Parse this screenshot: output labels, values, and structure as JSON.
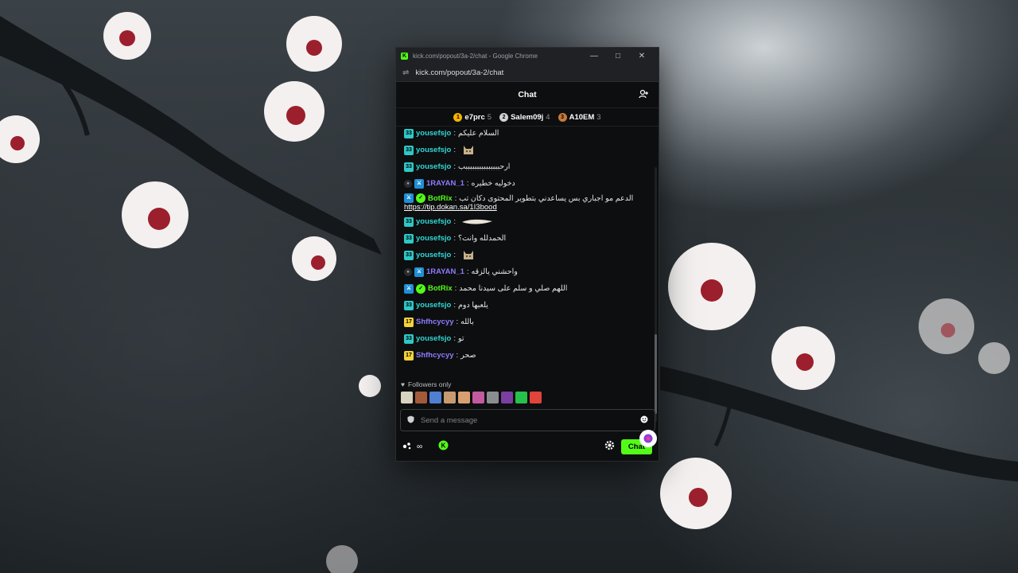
{
  "window": {
    "title": "kick.com/popout/3a-2/chat - Google Chrome",
    "url": "kick.com/popout/3a-2/chat"
  },
  "chat": {
    "header": "Chat",
    "leaderboard": [
      {
        "rank": "1",
        "name": "e7prc",
        "count": "5",
        "color": "#f5b400"
      },
      {
        "rank": "2",
        "name": "Salem09j",
        "count": "4",
        "color": "#cfd3d6"
      },
      {
        "rank": "3",
        "name": "A10EM",
        "count": "3",
        "color": "#c77a3a"
      }
    ],
    "messages": [
      {
        "badge": "33",
        "badge_type": "sub",
        "user": "yousefsjo",
        "sep": ":",
        "text": "السلام عليكم",
        "color": "#31d6d6"
      },
      {
        "badge": "33",
        "badge_type": "sub",
        "user": "yousefsjo",
        "sep": ":",
        "text": "",
        "emote": "cat-emote",
        "color": "#31d6d6"
      },
      {
        "badge": "33",
        "badge_type": "sub",
        "user": "yousefsjo",
        "sep": ":",
        "text": "ارحبببببببببببببببب",
        "color": "#31d6d6"
      },
      {
        "badge": "",
        "badge_type": "mod",
        "user": "1RAYAN_1",
        "sep": ":",
        "text": "دخوليه خطيره",
        "color": "#8c7cff"
      },
      {
        "badge": "",
        "badge_type": "bot",
        "user": "BotRix",
        "sep": ":",
        "text": "الدعم مو اجباري بس يساعدني بتطوير المحتوى دكان تب",
        "link": "https://tip.dokan.sa/1I3bood",
        "color": "#53fc18"
      },
      {
        "badge": "33",
        "badge_type": "sub",
        "user": "yousefsjo",
        "sep": ":",
        "text": "",
        "emote": "long-emote",
        "color": "#31d6d6"
      },
      {
        "badge": "33",
        "badge_type": "sub",
        "user": "yousefsjo",
        "sep": ":",
        "text": "الحمدلله وانت؟",
        "color": "#31d6d6"
      },
      {
        "badge": "33",
        "badge_type": "sub",
        "user": "yousefsjo",
        "sep": ":",
        "text": "",
        "emote": "cat-emote",
        "color": "#31d6d6"
      },
      {
        "badge": "",
        "badge_type": "mod",
        "user": "1RAYAN_1",
        "sep": ":",
        "text": "واحشني يالزقه",
        "color": "#8c7cff"
      },
      {
        "badge": "",
        "badge_type": "bot",
        "user": "BotRix",
        "sep": ":",
        "text": "اللهم صلي و سلم على سيدنا محمد",
        "color": "#53fc18"
      },
      {
        "badge": "33",
        "badge_type": "sub",
        "user": "yousefsjo",
        "sep": ":",
        "text": "يلعبها دوم",
        "color": "#31d6d6"
      },
      {
        "badge": "17",
        "badge_type": "sub17",
        "user": "Shfhcycyy",
        "sep": ":",
        "text": "بالله",
        "color": "#8c7cff"
      },
      {
        "badge": "33",
        "badge_type": "sub",
        "user": "yousefsjo",
        "sep": ":",
        "text": "تو",
        "color": "#31d6d6"
      },
      {
        "badge": "17",
        "badge_type": "sub17",
        "user": "Shfhcycyy",
        "sep": ":",
        "text": "صحر",
        "color": "#8c7cff"
      }
    ],
    "followers_label": "Followers only",
    "emote_bar": [
      "#d8d2c0",
      "#a35a3a",
      "#4e7fd0",
      "#c89a70",
      "#d8a070",
      "#c25aa0",
      "#8a8d90",
      "#7a3fa0",
      "#27c04a",
      "#e0443a"
    ],
    "input_placeholder": "Send a message",
    "footer_count": "∞",
    "send_label": "Chat"
  }
}
